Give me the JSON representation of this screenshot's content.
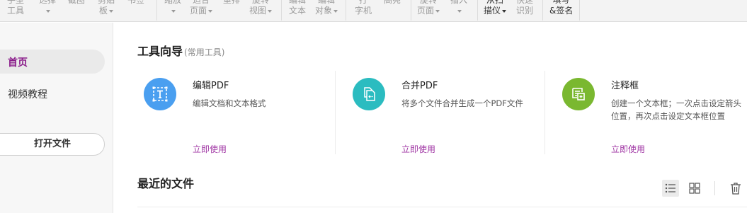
{
  "toolbar": {
    "items": [
      {
        "l1": "手型",
        "l2": "工具"
      },
      {
        "l1": "选择",
        "caret": true
      },
      {
        "l1": "截图"
      },
      {
        "l1": "剪贴",
        "l2": "板",
        "caret": true
      },
      {
        "l1": "书签"
      },
      {
        "l1": "缩放",
        "caret": true
      },
      {
        "l1": "适合",
        "l2": "页面",
        "caret": true
      },
      {
        "l1": "重排"
      },
      {
        "l1": "旋转",
        "l2": "视图",
        "caret": true
      },
      {
        "l1": "编辑",
        "l2": "文本"
      },
      {
        "l1": "编辑",
        "l2": "对象",
        "caret": true
      },
      {
        "l1": "打",
        "l2": "字机"
      },
      {
        "l1": "高亮"
      },
      {
        "l1": "旋转",
        "l2": "页面",
        "caret": true
      },
      {
        "l1": "插入",
        "caret": true
      },
      {
        "l1": "从扫",
        "l2": "描仪",
        "caret": true
      },
      {
        "l1": "快速",
        "l2": "识别"
      },
      {
        "l1": "填写",
        "l2": "&签名"
      }
    ]
  },
  "sidebar": {
    "home": "首页",
    "video": "视频教程",
    "open_file": "打开文件"
  },
  "tools": {
    "title": "工具向导",
    "subtitle": "(常用工具)",
    "cards": [
      {
        "icon": "edit-pdf-icon",
        "color": "#4a9ff0",
        "title": "编辑PDF",
        "desc": "编辑文档和文本格式",
        "link": "立即使用"
      },
      {
        "icon": "merge-pdf-icon",
        "color": "#2bbcc0",
        "title": "合并PDF",
        "desc": "将多个文件合并生成一个PDF文件",
        "link": "立即使用"
      },
      {
        "icon": "comment-box-icon",
        "color": "#7ab830",
        "title": "注释框",
        "desc": "创建一个文本框；一次点击设定箭头位置，再次点击设定文本框位置",
        "link": "立即使用"
      }
    ]
  },
  "recent": {
    "title": "最近的文件"
  },
  "colors": {
    "accent": "#8b1e8b",
    "link": "#a23aa6"
  }
}
